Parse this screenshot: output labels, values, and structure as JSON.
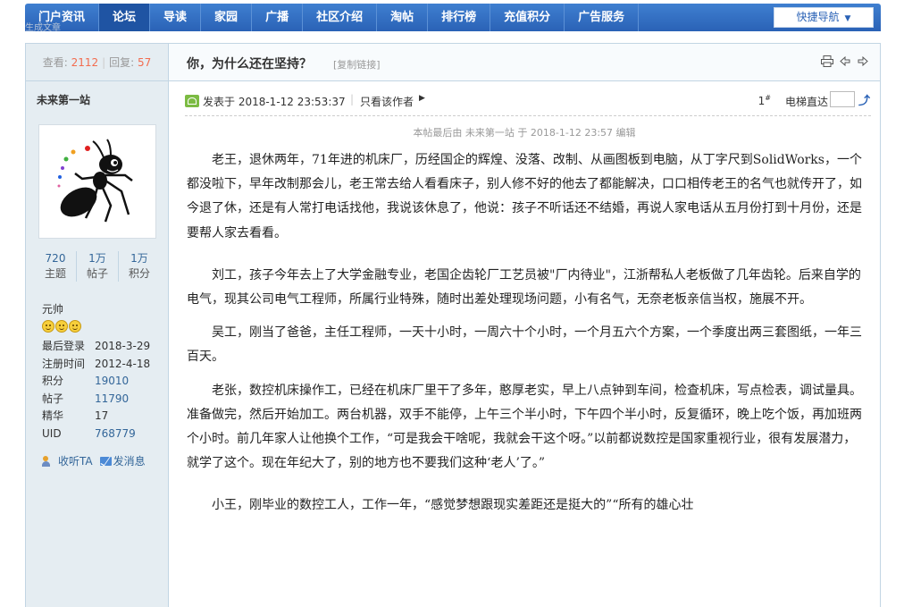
{
  "nav": {
    "items": [
      "门户资讯",
      "论坛",
      "导读",
      "家园",
      "广播",
      "社区介绍",
      "淘帖",
      "排行榜",
      "充值积分",
      "广告服务"
    ],
    "active_index": 1,
    "quick_nav": "快捷导航"
  },
  "ghost_text": "生成文章",
  "stats": {
    "views_label": "查看:",
    "views": "2112",
    "replies_label": "回复:",
    "replies": "57"
  },
  "user": {
    "name": "未来第一站",
    "counts": [
      {
        "value": "720",
        "label": "主题"
      },
      {
        "value": "1万",
        "label": "帖子"
      },
      {
        "value": "1万",
        "label": "积分"
      }
    ],
    "rank": "元帅",
    "info": [
      {
        "key": "最后登录",
        "value": "2018-3-29"
      },
      {
        "key": "注册时间",
        "value": "2012-4-18"
      },
      {
        "key": "积分",
        "value": "19010"
      },
      {
        "key": "帖子",
        "value": "11790"
      },
      {
        "key": "精华",
        "value": "17"
      },
      {
        "key": "UID",
        "value": "768779"
      }
    ],
    "follow": "收听TA",
    "message": "发消息"
  },
  "thread": {
    "title": "你，为什么还在坚持？",
    "copy_link": "[复制链接]",
    "posted": "发表于 2018-1-12 23:53:37",
    "only_author": "只看该作者",
    "floor": "1",
    "floor_suffix": "#",
    "jump_label": "电梯直达",
    "edited": "本帖最后由 未来第一站 于 2018-1-12 23:57 编辑",
    "paragraphs": [
      "老王，退休两年，71年进的机床厂，历经国企的辉煌、没落、改制、从画图板到电脑，从丁字尺到SolidWorks，一个都没啦下，早年改制那会儿，老王常去给人看看床子，别人修不好的他去了都能解决，口口相传老王的名气也就传开了，如今退了休，还是有人常打电话找他，我说该休息了，他说：孩子不听话还不结婚，再说人家电话从五月份打到十月份，还是要帮人家去看看。",
      "刘工，孩子今年去上了大学金融专业，老国企齿轮厂工艺员被\"厂内待业\"，江浙帮私人老板做了几年齿轮。后来自学的电气，现其公司电气工程师，所属行业特殊，随时出差处理现场问题，小有名气，无奈老板亲信当权，施展不开。",
      "吴工，刚当了爸爸，主任工程师，一天十小时，一周六十个小时，一个月五六个方案，一个季度出两三套图纸，一年三百天。",
      "老张，数控机床操作工，已经在机床厂里干了多年，憨厚老实，早上八点钟到车间，检查机床，写点检表，调试量具。准备做完，然后开始加工。两台机器，双手不能停，上午三个半小时，下午四个半小时，反复循环，晚上吃个饭，再加班两个小时。前几年家人让他换个工作，“可是我会干啥呢，我就会干这个呀。”以前都说数控是国家重视行业，很有发展潜力，就学了这个。现在年纪大了，别的地方也不要我们这种‘老人’了。”",
      "小王，刚毕业的数控工人，工作一年，“感觉梦想跟现实差距还是挺大的”“所有的雄心壮"
    ]
  }
}
